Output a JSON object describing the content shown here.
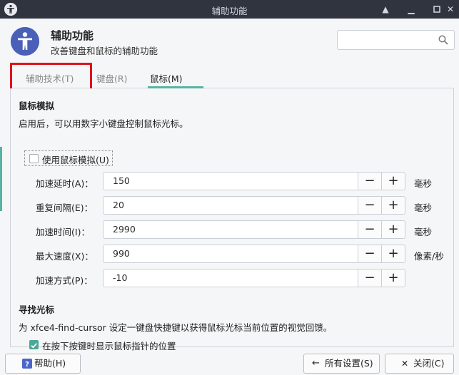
{
  "window": {
    "title": "辅助功能"
  },
  "header": {
    "title": "辅助功能",
    "subtitle": "改善键盘和鼠标的辅助功能",
    "search_placeholder": ""
  },
  "tabs": [
    {
      "label": "辅助技术(T)",
      "active": false
    },
    {
      "label": "键盘(R)",
      "active": false
    },
    {
      "label": "鼠标(M)",
      "active": true
    }
  ],
  "mouse_emulation": {
    "title": "鼠标模拟",
    "description": "启用后，可以用数字小键盘控制鼠标光标。",
    "enable_label": "使用鼠标模拟(U)",
    "enabled": false,
    "rows": [
      {
        "label": "加速延时(A)：",
        "value": "150",
        "unit": "毫秒"
      },
      {
        "label": "重复间隔(E)：",
        "value": "20",
        "unit": "毫秒"
      },
      {
        "label": "加速时间(I)：",
        "value": "2990",
        "unit": "毫秒"
      },
      {
        "label": "最大速度(X)：",
        "value": "990",
        "unit": "像素/秒"
      },
      {
        "label": "加速方式(P)：",
        "value": "-10",
        "unit": ""
      }
    ]
  },
  "find_cursor": {
    "title": "寻找光标",
    "description": "为 xfce4-find-cursor 设定一键盘快捷键以获得鼠标光标当前位置的视觉回馈。",
    "option_label": "在按下按键时显示鼠标指针的位置",
    "option_checked": true
  },
  "footer": {
    "help": "帮助(H)",
    "all_settings": "所有设置(S)",
    "close": "关闭(C)"
  },
  "colors": {
    "accent": "#56b3a3",
    "highlight": "#e0121b",
    "icon_blue": "#4a5fb8"
  }
}
